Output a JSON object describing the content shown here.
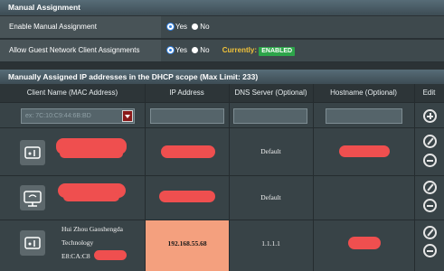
{
  "manual": {
    "title": "Manual Assignment",
    "enable_label": "Enable Manual Assignment",
    "guest_label": "Allow Guest Network Client Assignments",
    "yes": "Yes",
    "no": "No",
    "currently_label": "Currently:",
    "currently_value": "ENABLED"
  },
  "table": {
    "title": "Manually Assigned IP addresses in the DHCP scope (Max Limit: 233)",
    "headers": [
      "Client Name (MAC Address)",
      "IP Address",
      "DNS Server (Optional)",
      "Hostname (Optional)",
      "Edit"
    ],
    "select_placeholder": "ex: 7C:10:C9:44:6B:BD",
    "rows": [
      {
        "dns": "Default"
      },
      {
        "dns": "Default"
      },
      {
        "client_line1": "Hui Zhou Gaoshengda",
        "client_line2": "Technology",
        "client_line3": "E8:CA:C8",
        "ip": "192.168.55.68",
        "dns": "1.1.1.1"
      }
    ]
  },
  "icons": [
    "plus-circle-icon",
    "edit-pencil-icon",
    "minus-circle-icon",
    "router-device-icon",
    "monitor-device-icon",
    "dropdown-arrow-icon"
  ],
  "colors": {
    "accent": "#2f7fe0",
    "enabled": "#2da54a",
    "currently": "#f0c23a",
    "redaction": "#ef4f4f",
    "ip_highlight": "#f4a07e"
  }
}
